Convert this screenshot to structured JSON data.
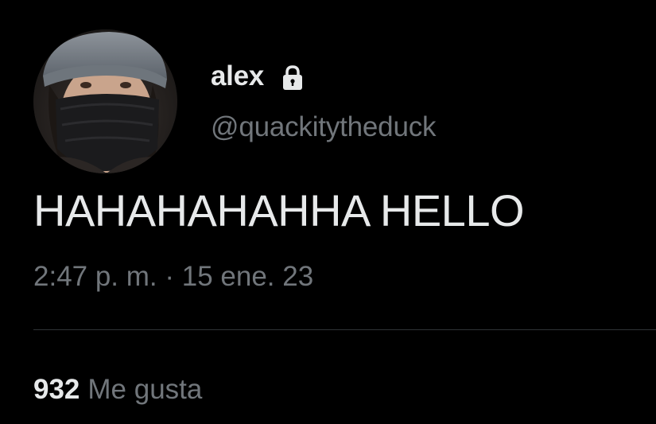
{
  "tweet": {
    "author": {
      "display_name": "alex",
      "handle": "@quackitytheduck",
      "protected_icon": "lock-icon",
      "avatar_icon": "avatar"
    },
    "text": "HAHAHAHAHHA HELLO",
    "timestamp": "2:47 p. m. · 15 ene. 23",
    "stats": {
      "likes_count": "932",
      "likes_label": "Me gusta"
    }
  },
  "colors": {
    "background": "#000000",
    "primary_text": "#e7e9ea",
    "secondary_text": "#71767b",
    "divider": "#2f3336"
  }
}
